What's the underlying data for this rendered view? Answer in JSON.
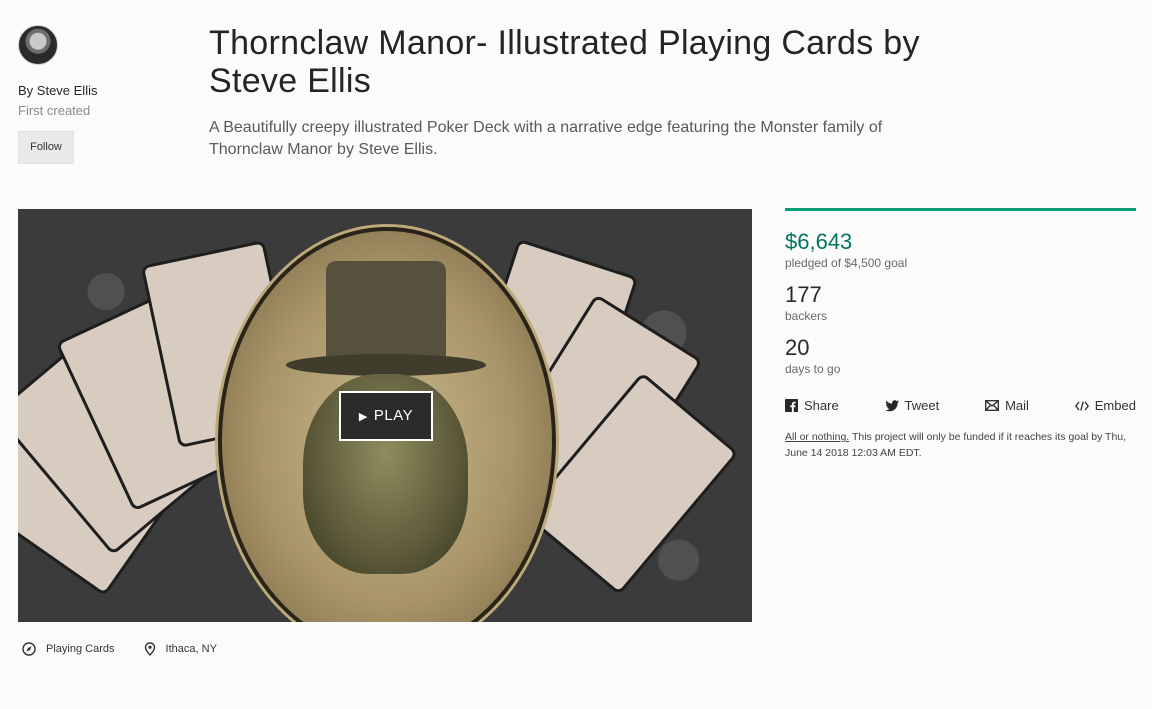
{
  "creator": {
    "by_line": "By Steve Ellis",
    "first_created": "First created",
    "follow_label": "Follow"
  },
  "project": {
    "title": "Thornclaw Manor- Illustrated Playing Cards by Steve Ellis",
    "blurb": "A Beautifully creepy illustrated Poker Deck with a narrative edge featuring the Monster family of Thornclaw Manor by Steve Ellis."
  },
  "video": {
    "play_label": "PLAY"
  },
  "meta": {
    "category": "Playing Cards",
    "location": "Ithaca, NY"
  },
  "stats": {
    "funding_progress": 1.0,
    "pledged": "$6,643",
    "pledged_label": "pledged of $4,500 goal",
    "backers": "177",
    "backers_label": "backers",
    "days": "20",
    "days_label": "days to go"
  },
  "share": {
    "share": "Share",
    "tweet": "Tweet",
    "mail": "Mail",
    "embed": "Embed"
  },
  "all_or_nothing": {
    "link": "All or nothing.",
    "text": " This project will only be funded if it reaches its goal by Thu, June 14 2018 12:03 AM EDT."
  },
  "colors": {
    "accent": "#009e74",
    "pledged": "#037362"
  },
  "icons": {
    "category": "compass-icon",
    "location": "map-pin-icon",
    "share": "facebook-icon",
    "tweet": "twitter-icon",
    "mail": "mail-icon",
    "embed": "code-icon"
  }
}
